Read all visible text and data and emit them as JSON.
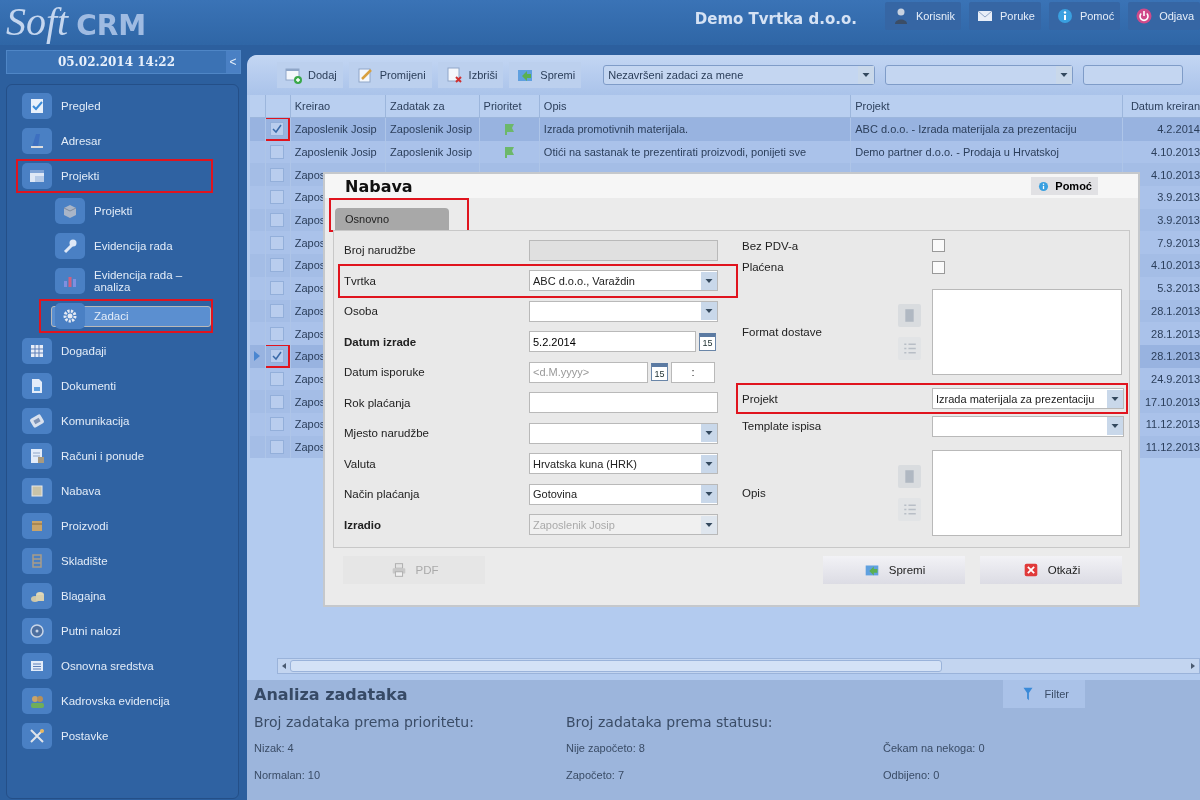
{
  "header": {
    "logo_main": "Soft",
    "logo_accent": "CRM",
    "company": "Demo Tvrtka d.o.o.",
    "buttons": [
      {
        "label": "Korisnik",
        "kind": "user"
      },
      {
        "label": "Poruke",
        "kind": "mail"
      },
      {
        "label": "Pomoć",
        "kind": "info"
      },
      {
        "label": "Odjava",
        "kind": "power"
      }
    ]
  },
  "sidebar": {
    "datetime": "05.02.2014 14:22",
    "collapse": "<",
    "items": [
      {
        "label": "Pregled",
        "kind": "checklist",
        "selected": false,
        "highlighted": false
      },
      {
        "label": "Adresar",
        "kind": "book",
        "selected": false,
        "highlighted": false
      },
      {
        "label": "Projekti",
        "kind": "window",
        "selected": false,
        "highlighted": true,
        "children": [
          {
            "label": "Projekti",
            "kind": "box",
            "selected": false,
            "highlighted": false
          },
          {
            "label": "Evidencija rada",
            "kind": "wrench",
            "selected": false,
            "highlighted": false
          },
          {
            "label": "Evidencija rada – analiza",
            "kind": "chart",
            "selected": false,
            "highlighted": false
          },
          {
            "label": "Zadaci",
            "kind": "gear",
            "selected": true,
            "highlighted": true
          }
        ]
      },
      {
        "label": "Događaji",
        "kind": "calendar",
        "selected": false,
        "highlighted": false
      },
      {
        "label": "Dokumenti",
        "kind": "document",
        "selected": false,
        "highlighted": false
      },
      {
        "label": "Komunikacija",
        "kind": "phone",
        "selected": false,
        "highlighted": false
      },
      {
        "label": "Računi i ponude",
        "kind": "invoice",
        "selected": false,
        "highlighted": false
      },
      {
        "label": "Nabava",
        "kind": "frame",
        "selected": false,
        "highlighted": false
      },
      {
        "label": "Proizvodi",
        "kind": "drawer",
        "selected": false,
        "highlighted": false
      },
      {
        "label": "Skladište",
        "kind": "shelf",
        "selected": false,
        "highlighted": false
      },
      {
        "label": "Blagajna",
        "kind": "coins",
        "selected": false,
        "highlighted": false
      },
      {
        "label": "Putni nalozi",
        "kind": "disc",
        "selected": false,
        "highlighted": false
      },
      {
        "label": "Osnovna sredstva",
        "kind": "list",
        "selected": false,
        "highlighted": false
      },
      {
        "label": "Kadrovska evidencija",
        "kind": "people",
        "selected": false,
        "highlighted": false
      },
      {
        "label": "Postavke",
        "kind": "tools",
        "selected": false,
        "highlighted": false
      }
    ]
  },
  "toolbar": {
    "buttons": [
      {
        "label": "Dodaj",
        "kind": "add"
      },
      {
        "label": "Promijeni",
        "kind": "edit"
      },
      {
        "label": "Izbriši",
        "kind": "delete"
      },
      {
        "label": "Spremi",
        "kind": "save"
      }
    ],
    "filters": [
      {
        "kind": "select",
        "value": "Nezavršeni zadaci za mene"
      },
      {
        "kind": "select"
      },
      {
        "kind": "text"
      }
    ]
  },
  "table": {
    "columns": [
      "Kreirao",
      "Zadatak za",
      "Prioritet",
      "Opis",
      "Projekt",
      "Datum kreiran"
    ],
    "rows": [
      {
        "checked": true,
        "current": false,
        "highlighted": true,
        "created_by": "Zaposlenik Josip",
        "assignee": "Zaposlenik Josip",
        "flagged": true,
        "description": "Izrada promotivnih materijala.",
        "project": "ABC d.o.o. - Izrada materijala za prezentaciju",
        "date": "4.2.2014"
      },
      {
        "checked": false,
        "current": false,
        "highlighted": false,
        "created_by": "Zaposlenik Josip",
        "assignee": "Zaposlenik Josip",
        "flagged": true,
        "description": "Otići na sastanak te prezentirati proizvodi, ponijeti sve",
        "project": "Demo partner d.o.o. - Prodaja u Hrvatskoj",
        "date": "4.10.2013"
      },
      {
        "checked": false,
        "current": false,
        "highlighted": false,
        "created_by": "Zapos",
        "date": "4.10.2013"
      },
      {
        "checked": false,
        "current": false,
        "highlighted": false,
        "created_by": "Zapos",
        "date": "3.9.2013"
      },
      {
        "checked": false,
        "current": false,
        "highlighted": false,
        "created_by": "Zapos",
        "date": "3.9.2013"
      },
      {
        "checked": false,
        "current": false,
        "highlighted": false,
        "created_by": "Zapos",
        "date": "7.9.2013"
      },
      {
        "checked": false,
        "current": false,
        "highlighted": false,
        "created_by": "Zapos",
        "date": "4.10.2013"
      },
      {
        "checked": false,
        "current": false,
        "highlighted": false,
        "created_by": "Zapos",
        "date": "5.3.2013"
      },
      {
        "checked": false,
        "current": false,
        "highlighted": false,
        "created_by": "Zapos",
        "date": "28.1.2013"
      },
      {
        "checked": false,
        "current": false,
        "highlighted": false,
        "created_by": "Zapos",
        "date": "28.1.2013"
      },
      {
        "checked": true,
        "current": true,
        "highlighted": true,
        "created_by": "Zapos",
        "date": "28.1.2013"
      },
      {
        "checked": false,
        "current": false,
        "highlighted": false,
        "created_by": "Zapos",
        "date": "24.9.2013"
      },
      {
        "checked": false,
        "current": false,
        "highlighted": false,
        "created_by": "Zapos",
        "date": "17.10.2013"
      },
      {
        "checked": false,
        "current": false,
        "highlighted": false,
        "created_by": "Zapos",
        "date": "11.12.2013"
      },
      {
        "checked": false,
        "current": false,
        "highlighted": false,
        "created_by": "Zapos",
        "date": "11.12.2013"
      }
    ]
  },
  "analysis": {
    "title": "Analiza zadataka",
    "filter_button": "Filter",
    "groups": [
      {
        "heading": "Broj zadataka prema prioritetu:",
        "items": [
          "Nizak: 4",
          "Normalan: 10"
        ]
      },
      {
        "heading": "Broj zadataka prema statusu:",
        "items": [
          "Nije započeto: 8",
          "Čekam na nekoga: 0",
          "Započeto: 7",
          "Odbijeno: 0"
        ]
      }
    ]
  },
  "dialog": {
    "title": "Nabava",
    "help": "Pomoć",
    "tabs": [
      {
        "label": "Osnovno",
        "selected": true,
        "highlighted": true
      }
    ],
    "left_fields": [
      {
        "label": "Broj narudžbe",
        "kind": "text",
        "required": false,
        "disabled": true,
        "highlighted": false
      },
      {
        "label": "Tvrtka",
        "kind": "select",
        "value": "ABC d.o.o., Varaždin",
        "required": false,
        "disabled": false,
        "highlighted": true
      },
      {
        "label": "Osoba",
        "kind": "select",
        "required": false,
        "disabled": false,
        "highlighted": false
      },
      {
        "label": "Datum izrade",
        "kind": "date",
        "value": "5.2.2014",
        "calendar_day": "15",
        "required": true,
        "disabled": false,
        "highlighted": false
      },
      {
        "label": "Datum isporuke",
        "kind": "datetime",
        "placeholder": "<d.M.yyyy>",
        "calendar_day": "15",
        "time": ":",
        "required": false,
        "disabled": false,
        "highlighted": false
      },
      {
        "label": "Rok plaćanja",
        "kind": "text",
        "required": false,
        "disabled": false,
        "highlighted": false
      },
      {
        "label": "Mjesto narudžbe",
        "kind": "select",
        "required": false,
        "disabled": false,
        "highlighted": false
      },
      {
        "label": "Valuta",
        "kind": "select",
        "value": "Hrvatska kuna (HRK)",
        "required": false,
        "disabled": false,
        "highlighted": false
      },
      {
        "label": "Način plaćanja",
        "kind": "select",
        "value": "Gotovina",
        "required": false,
        "disabled": false,
        "highlighted": false
      },
      {
        "label": "Izradio",
        "kind": "select",
        "value": "Zaposlenik Josip",
        "required": true,
        "disabled": true,
        "highlighted": false
      }
    ],
    "right_fields": [
      {
        "label": "Bez PDV-a",
        "kind": "checkbox",
        "checked": false,
        "highlighted": false
      },
      {
        "label": "Plaćena",
        "kind": "checkbox",
        "checked": false,
        "highlighted": false
      },
      {
        "label": "Format dostave",
        "kind": "textarea",
        "highlighted": false
      },
      {
        "label": "Projekt",
        "kind": "select",
        "value": "Izrada materijala za prezentaciju",
        "highlighted": true
      },
      {
        "label": "Template ispisa",
        "kind": "select",
        "highlighted": false
      },
      {
        "label": "Opis",
        "kind": "textarea",
        "highlighted": false
      }
    ],
    "buttons": [
      {
        "label": "PDF",
        "kind": "print",
        "disabled": true
      },
      {
        "label": "Spremi",
        "kind": "save",
        "disabled": false
      },
      {
        "label": "Otkaži",
        "kind": "cancel",
        "disabled": false
      }
    ]
  }
}
